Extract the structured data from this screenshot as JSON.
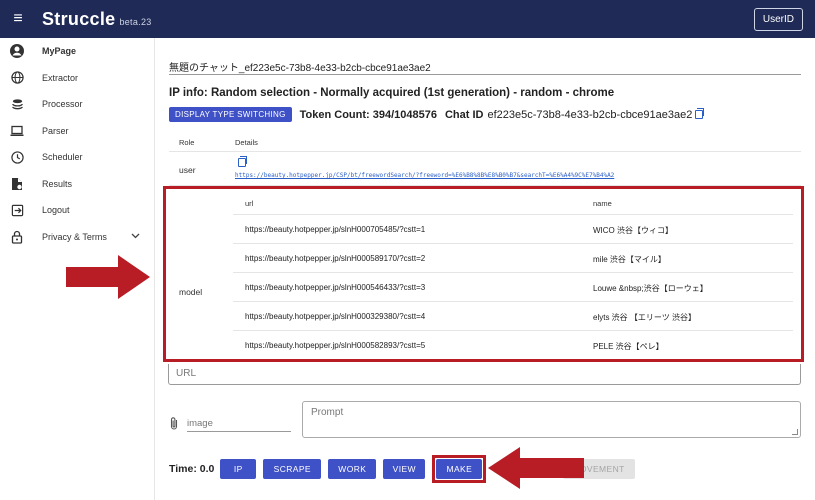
{
  "topbar": {
    "brand": "Struccle",
    "version": "beta.23",
    "userid_label": "UserID"
  },
  "sidebar": {
    "items": [
      {
        "label": "MyPage",
        "icon": "account-circle-icon"
      },
      {
        "label": "Extractor",
        "icon": "globe-icon"
      },
      {
        "label": "Processor",
        "icon": "layers-icon"
      },
      {
        "label": "Parser",
        "icon": "laptop-icon"
      },
      {
        "label": "Scheduler",
        "icon": "clock-icon"
      },
      {
        "label": "Results",
        "icon": "document-icon"
      },
      {
        "label": "Logout",
        "icon": "logout-icon"
      },
      {
        "label": "Privacy & Terms",
        "icon": "lock-icon"
      }
    ]
  },
  "main": {
    "chat_title": "無題のチャット_ef223e5c-73b8-4e33-b2cb-cbce91ae3ae2",
    "ip_info": "IP info: Random selection - Normally acquired (1st generation) - random - chrome",
    "display_type_button": "DISPLAY TYPE SWITCHING",
    "token_count": "Token Count: 394/1048576",
    "chat_id_label": "Chat ID",
    "chat_id_value": "ef223e5c-73b8-4e33-b2cb-cbce91ae3ae2",
    "table": {
      "col_role": "Role",
      "col_details": "Details",
      "user_role": "user",
      "user_link": "https://beauty.hotpepper.jp/CSP/bt/freewordSearch/?freeword=%E6%B8%8B%E8%B0%B7&searchT=%E6%A4%9C%E7%B4%A2",
      "model_role": "model",
      "model_table": {
        "col_url": "url",
        "col_name": "name",
        "rows": [
          {
            "url": "https://beauty.hotpepper.jp/slnH000705485/?cstt=1",
            "name": "WICO 渋谷【ウィコ】"
          },
          {
            "url": "https://beauty.hotpepper.jp/slnH000589170/?cstt=2",
            "name": "mile 渋谷【マイル】"
          },
          {
            "url": "https://beauty.hotpepper.jp/slnH000546433/?cstt=3",
            "name": "Louwe &nbsp;渋谷【ローウェ】"
          },
          {
            "url": "https://beauty.hotpepper.jp/slnH000329380/?cstt=4",
            "name": "elyts 渋谷 【エリーツ 渋谷】"
          },
          {
            "url": "https://beauty.hotpepper.jp/slnH000582893/?cstt=5",
            "name": "PELE 渋谷【ペレ】"
          }
        ]
      }
    },
    "url_placeholder": "URL",
    "image_placeholder": "image",
    "prompt_placeholder": "Prompt",
    "time": "Time: 0.0",
    "buttons": {
      "ip": "IP",
      "scrape": "SCRAPE",
      "work": "WORK",
      "view": "VIEW",
      "make": "MAKE",
      "improvement": "ROVEMENT"
    }
  },
  "colors": {
    "topbar": "#1f2a56",
    "primary_button": "#3f51c6",
    "highlight_red": "#b81c25",
    "link": "#2b5fc8"
  }
}
